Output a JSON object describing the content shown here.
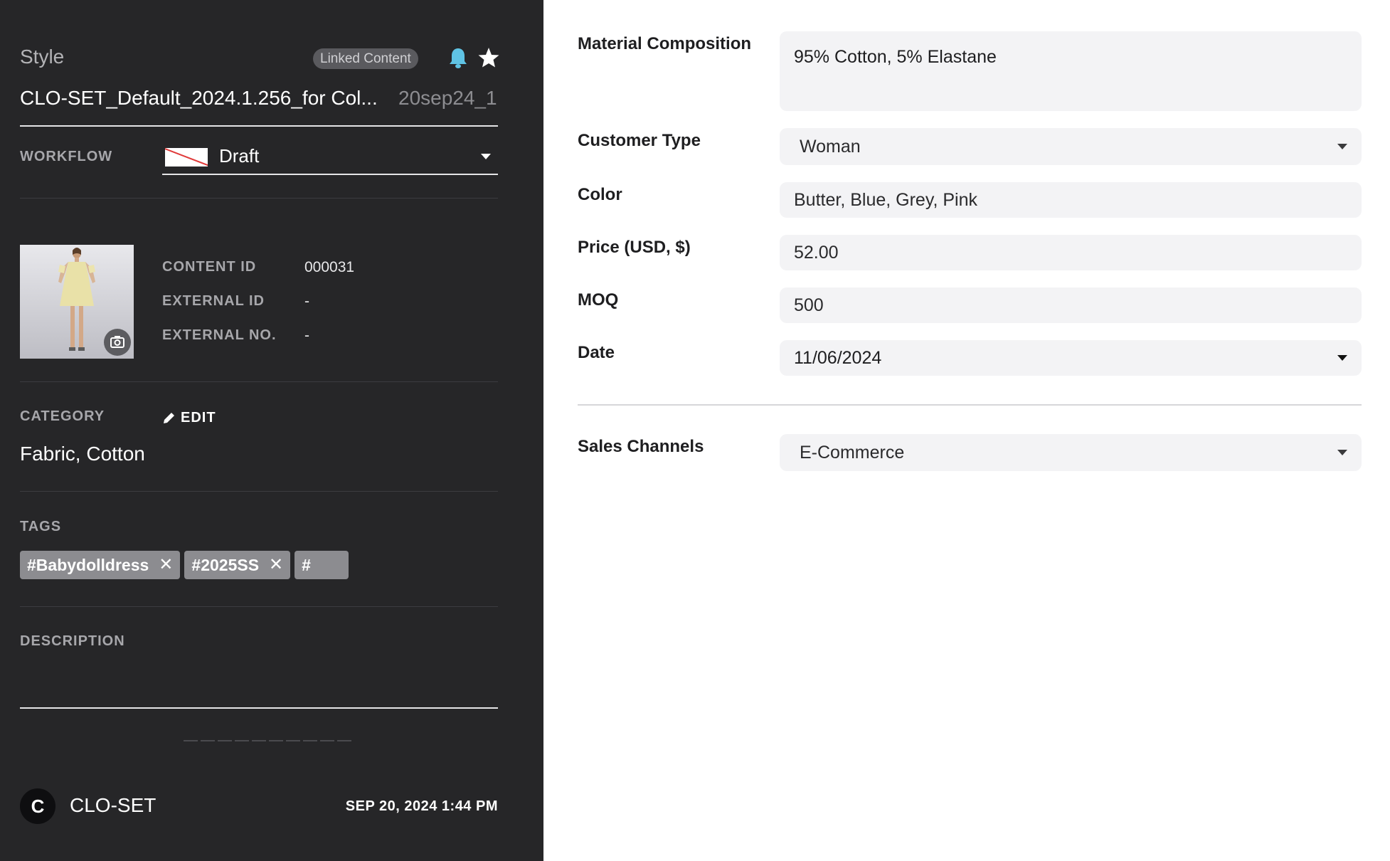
{
  "header": {
    "title": "Style",
    "linked_badge": "Linked Content",
    "style_name": "CLO-SET_Default_2024.1.256_for Col...",
    "version": "20sep24_1"
  },
  "workflow": {
    "label": "WORKFLOW",
    "value": "Draft"
  },
  "meta": {
    "content_id_label": "CONTENT ID",
    "content_id": "000031",
    "external_id_label": "EXTERNAL ID",
    "external_id": "-",
    "external_no_label": "EXTERNAL NO.",
    "external_no": "-"
  },
  "category": {
    "label": "CATEGORY",
    "edit_label": "EDIT",
    "value": "Fabric, Cotton"
  },
  "tags": {
    "label": "TAGS",
    "items": [
      "#Babydolldress",
      "#2025SS"
    ],
    "input_prefix": "#"
  },
  "description": {
    "label": "DESCRIPTION"
  },
  "footer": {
    "avatar_initial": "C",
    "owner": "CLO-SET",
    "timestamp": "SEP 20, 2024 1:44 PM"
  },
  "fields": {
    "material_label": "Material Composition",
    "material_value": "95% Cotton, 5% Elastane",
    "customer_label": "Customer Type",
    "customer_value": "Woman",
    "color_label": "Color",
    "color_value": "Butter, Blue, Grey, Pink",
    "price_label": "Price (USD, $)",
    "price_value": "52.00",
    "moq_label": "MOQ",
    "moq_value": "500",
    "date_label": "Date",
    "date_value": "11/06/2024",
    "sales_label": "Sales Channels",
    "sales_value": "E-Commerce"
  },
  "colors": {
    "left_bg": "#262628",
    "bell": "#5fc3e4",
    "tag_bg": "#8c8c90",
    "field_bg": "#f3f3f5"
  }
}
